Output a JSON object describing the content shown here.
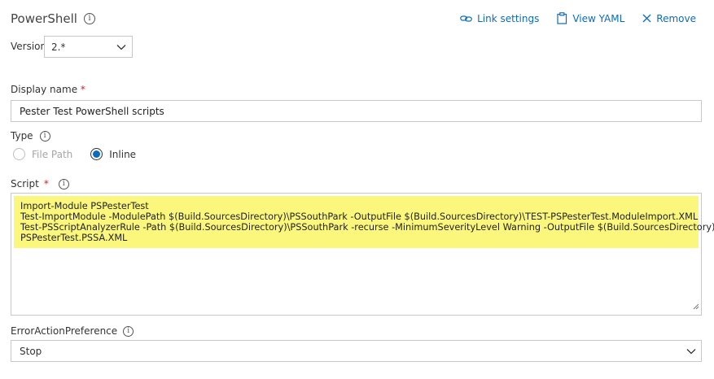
{
  "header": {
    "title": "PowerShell",
    "actions": {
      "link_settings": "Link settings",
      "view_yaml": "View YAML",
      "remove": "Remove"
    }
  },
  "version": {
    "label": "Version",
    "value": "2.*"
  },
  "display_name": {
    "label": "Display name",
    "required_mark": "*",
    "value": "Pester Test PowerShell scripts"
  },
  "type": {
    "label": "Type",
    "options": [
      {
        "label": "File Path",
        "selected": false
      },
      {
        "label": "Inline",
        "selected": true
      }
    ]
  },
  "script": {
    "label": "Script",
    "required_mark": "*",
    "lines": [
      "Import-Module PSPesterTest",
      "Test-ImportModule -ModulePath $(Build.SourcesDirectory)\\PSSouthPark -OutputFile $(Build.SourcesDirectory)\\TEST-PSPesterTest.ModuleImport.XML",
      "Test-PSScriptAnalyzerRule -Path $(Build.SourcesDirectory)\\PSSouthPark -recurse -MinimumSeverityLevel Warning -OutputFile $(Build.SourcesDirectory)\\TEST-",
      "PSPesterTest.PSSA.XML"
    ],
    "highlight_color": "#fbf77c"
  },
  "error_action_preference": {
    "label": "ErrorActionPreference",
    "value": "Stop"
  },
  "colors": {
    "accent": "#0b6cbd",
    "required": "#c4262e",
    "border": "#c8c8c8"
  },
  "icons": {
    "info": "info-icon",
    "link": "link-icon",
    "yaml": "clipboard-icon",
    "remove": "close-icon",
    "dropdown": "chevron-down-icon"
  }
}
